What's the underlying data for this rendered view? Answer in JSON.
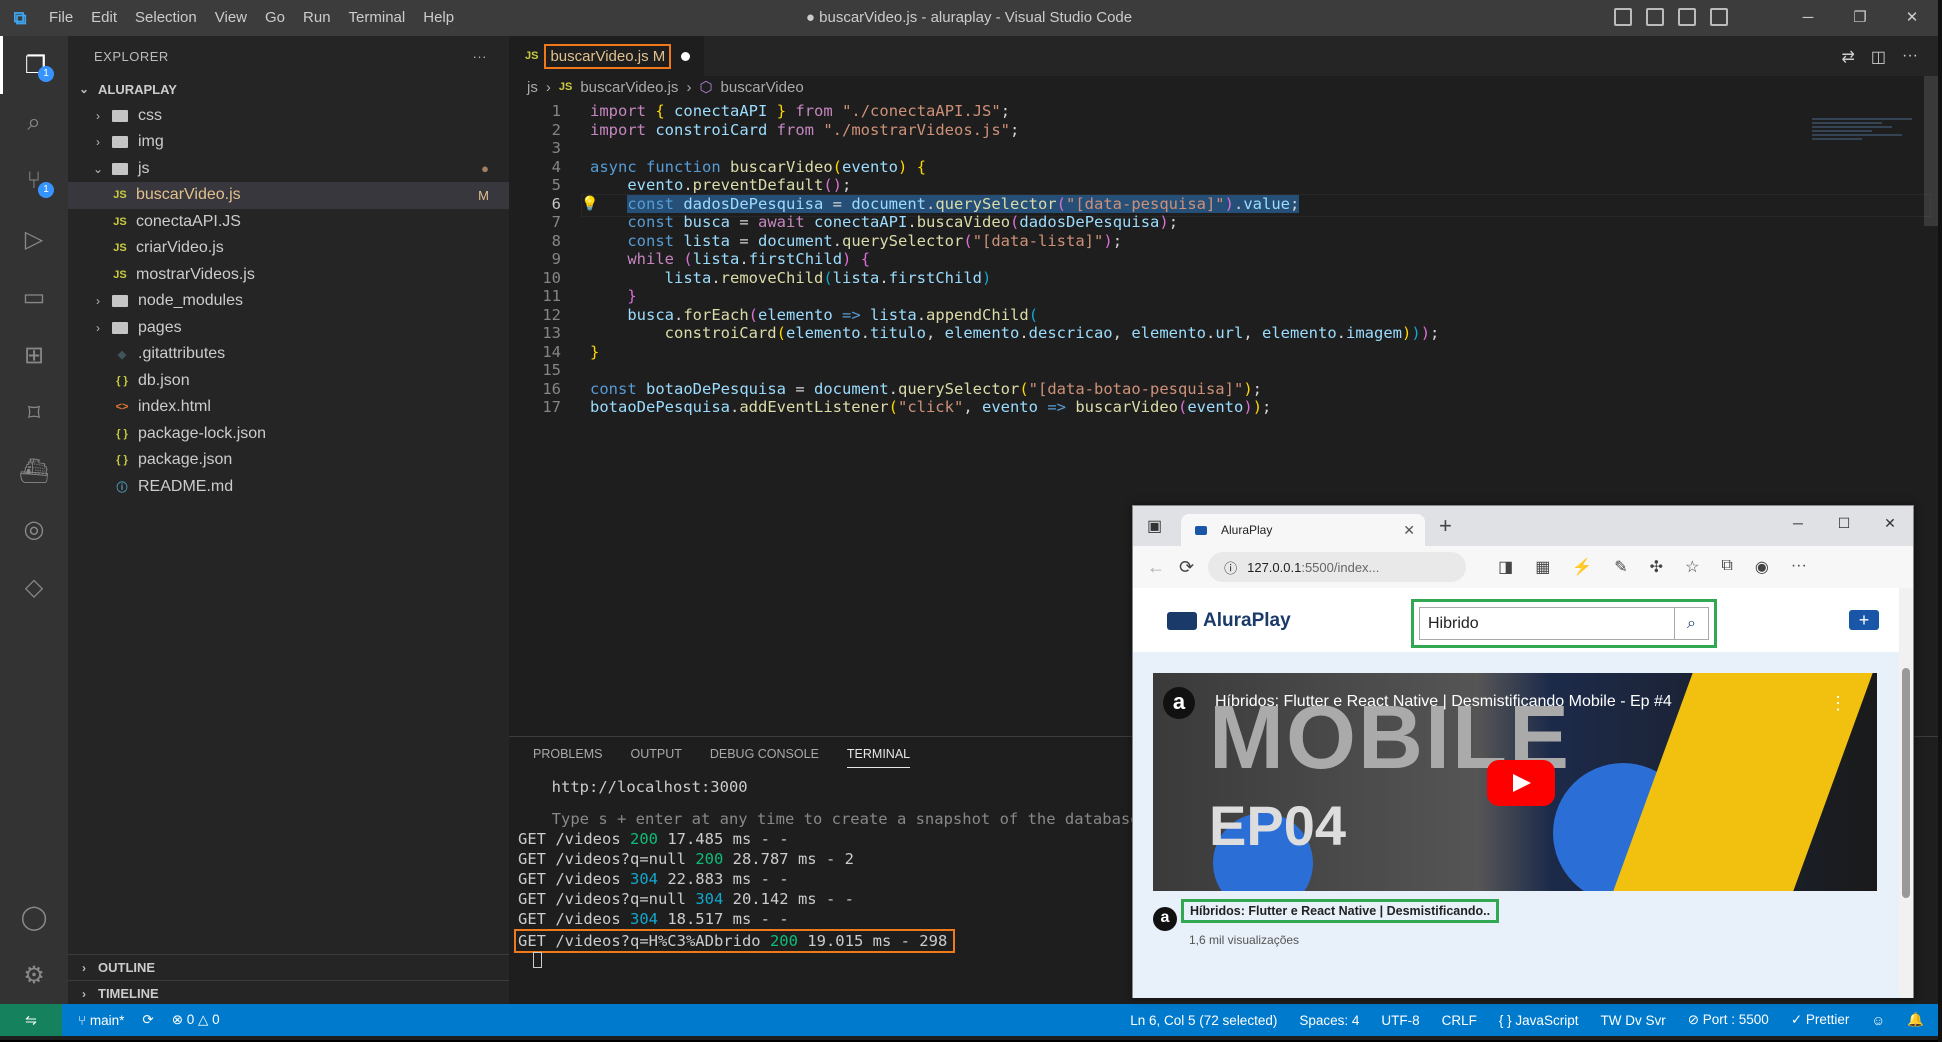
{
  "window": {
    "title": "● buscarVideo.js - aluraplay - Visual Studio Code",
    "menu": [
      "File",
      "Edit",
      "Selection",
      "View",
      "Go",
      "Run",
      "Terminal",
      "Help"
    ],
    "controls": [
      "─",
      "❐",
      "✕"
    ]
  },
  "activity_bar": {
    "explorer_badge": "1",
    "scm_badge": "1"
  },
  "sidebar": {
    "header": "EXPLORER",
    "more": "···",
    "root": "ALURAPLAY",
    "items": [
      {
        "label": "css",
        "kind": "folder",
        "indent": 1,
        "chev": "›"
      },
      {
        "label": "img",
        "kind": "folder",
        "indent": 1,
        "chev": "›"
      },
      {
        "label": "js",
        "kind": "folder",
        "indent": 1,
        "chev": "⌄",
        "mark": "●"
      },
      {
        "label": "buscarVideo.js",
        "kind": "js",
        "indent": 2,
        "mark": "M",
        "selected": true
      },
      {
        "label": "conectaAPI.JS",
        "kind": "js",
        "indent": 2
      },
      {
        "label": "criarVideo.js",
        "kind": "js",
        "indent": 2
      },
      {
        "label": "mostrarVideos.js",
        "kind": "js",
        "indent": 2
      },
      {
        "label": "node_modules",
        "kind": "folder",
        "indent": 1,
        "chev": "›"
      },
      {
        "label": "pages",
        "kind": "folder",
        "indent": 1,
        "chev": "›"
      },
      {
        "label": ".gitattributes",
        "kind": "git",
        "indent": 1
      },
      {
        "label": "db.json",
        "kind": "json",
        "indent": 1
      },
      {
        "label": "index.html",
        "kind": "html",
        "indent": 1
      },
      {
        "label": "package-lock.json",
        "kind": "json",
        "indent": 1
      },
      {
        "label": "package.json",
        "kind": "json",
        "indent": 1
      },
      {
        "label": "README.md",
        "kind": "info",
        "indent": 1
      }
    ],
    "outline": "OUTLINE",
    "timeline": "TIMELINE"
  },
  "editor": {
    "tab": {
      "icon": "JS",
      "name": "buscarVideo.js",
      "status": "M"
    },
    "breadcrumb": {
      "folder": "js",
      "icon": "JS",
      "file": "buscarVideo.js",
      "symbol": "buscarVideo"
    },
    "line_numbers": [
      "1",
      "2",
      "3",
      "4",
      "5",
      "6",
      "7",
      "8",
      "9",
      "10",
      "11",
      "12",
      "13",
      "14",
      "15",
      "16",
      "17"
    ],
    "current_line": 6
  },
  "panel": {
    "tabs": [
      "PROBLEMS",
      "OUTPUT",
      "DEBUG CONSOLE",
      "TERMINAL"
    ],
    "active_tab": "TERMINAL",
    "terminal": {
      "url_line": "  http://localhost:3000",
      "hint_line": "  Type s + enter at any time to create a snapshot of the database",
      "requests": [
        {
          "prefix": "GET /videos ",
          "code": "200",
          "ms": " 17.485 ms - -"
        },
        {
          "prefix": "GET /videos?q=null ",
          "code": "200",
          "ms": " 28.787 ms - 2"
        },
        {
          "prefix": "GET /videos ",
          "code": "304",
          "ms": " 22.883 ms - -"
        },
        {
          "prefix": "GET /videos?q=null ",
          "code": "304",
          "ms": " 20.142 ms - -"
        },
        {
          "prefix": "GET /videos ",
          "code": "304",
          "ms": " 18.517 ms - -"
        },
        {
          "prefix": "GET /videos?q=H%C3%ADbrido ",
          "code": "200",
          "ms": " 19.015 ms - 298"
        }
      ]
    }
  },
  "statusbar": {
    "remote": "⇋",
    "branch": "main*",
    "sync": "⟳",
    "errors": "⊗ 0 △ 0",
    "position": "Ln 6, Col 5 (72 selected)",
    "spaces": "Spaces: 4",
    "encoding": "UTF-8",
    "eol": "CRLF",
    "language": "{ } JavaScript",
    "tw": "TW Dv Svr",
    "port": "⊘ Port : 5500",
    "prettier": "✓ Prettier"
  },
  "browser": {
    "tab_title": "AluraPlay",
    "url_host": "127.0.0.1",
    "url_rest": ":5500/index...",
    "page": {
      "logo": "AluraPlay",
      "search_value": "Hibrido",
      "video": {
        "overlay_title": "Híbridos: Flutter e React Native | Desmistificando Mobile - Ep #4",
        "big_text": "MOBILE",
        "ep_text": "EP04",
        "card_title": "Híbridos: Flutter e React Native | Desmistificando..",
        "views": "1,6 mil visualizações"
      }
    }
  },
  "colors": {
    "accent": "#007acc",
    "highlight_orange": "#f07a1a",
    "highlight_green": "#32a852"
  }
}
